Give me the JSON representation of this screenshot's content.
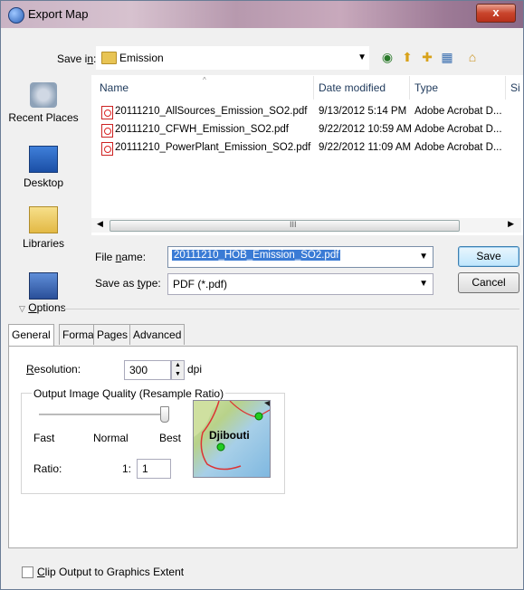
{
  "window": {
    "title": "Export Map",
    "close_label": "x"
  },
  "save_in": {
    "label": "Save in:",
    "value": "Emission"
  },
  "places": [
    {
      "label": "Recent Places",
      "icon": "recent-places-icon"
    },
    {
      "label": "Desktop",
      "icon": "desktop-icon"
    },
    {
      "label": "Libraries",
      "icon": "libraries-icon"
    },
    {
      "label": "",
      "icon": "computer-icon"
    }
  ],
  "columns": {
    "name": "Name",
    "date": "Date modified",
    "type": "Type",
    "size": "Si"
  },
  "files": [
    {
      "name": "20111210_AllSources_Emission_SO2.pdf",
      "date": "9/13/2012 5:14 PM",
      "type": "Adobe Acrobat D..."
    },
    {
      "name": "20111210_CFWH_Emission_SO2.pdf",
      "date": "9/22/2012 10:59 AM",
      "type": "Adobe Acrobat D..."
    },
    {
      "name": "20111210_PowerPlant_Emission_SO2.pdf",
      "date": "9/22/2012 11:09 AM",
      "type": "Adobe Acrobat D..."
    }
  ],
  "scrollbar": {
    "grip": "III"
  },
  "file_name": {
    "label": "File name:",
    "value": "20111210_HOB_Emission_SO2.pdf"
  },
  "save_as_type": {
    "label": "Save as type:",
    "value": "PDF (*.pdf)"
  },
  "buttons": {
    "save": "Save",
    "cancel": "Cancel"
  },
  "options_label": "Options",
  "tabs": [
    "General",
    "Format",
    "Pages",
    "Advanced"
  ],
  "resolution": {
    "label": "Resolution:",
    "value": "300",
    "unit": "dpi"
  },
  "quality": {
    "group_label": "Output Image Quality (Resample Ratio)",
    "fast": "Fast",
    "normal": "Normal",
    "best": "Best",
    "slider_level": 1.0,
    "ratio_label": "Ratio:",
    "ratio_prefix": "1:",
    "ratio_value": "1"
  },
  "preview": {
    "label": "Djibouti"
  },
  "clip": {
    "label": "Clip Output to Graphics Extent",
    "checked": false
  }
}
